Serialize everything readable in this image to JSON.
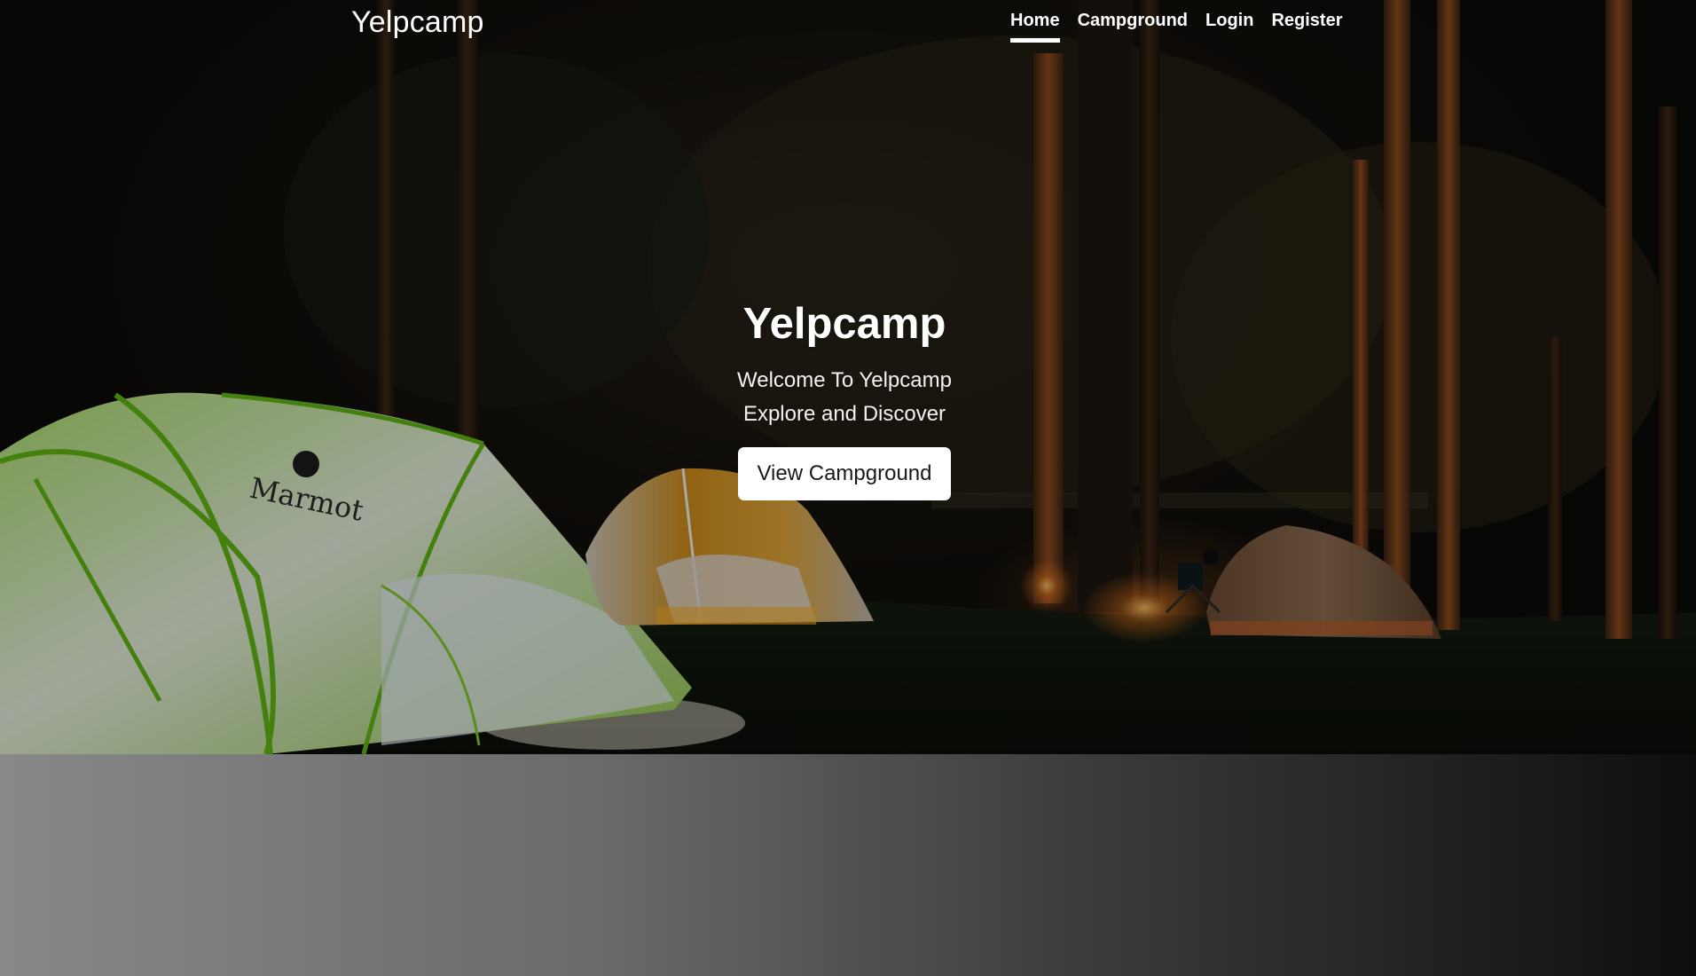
{
  "navbar": {
    "brand": "Yelpcamp",
    "links": [
      {
        "label": "Home",
        "active": true
      },
      {
        "label": "Campground",
        "active": false
      },
      {
        "label": "Login",
        "active": false
      },
      {
        "label": "Register",
        "active": false
      }
    ]
  },
  "hero": {
    "title": "Yelpcamp",
    "line1": "Welcome To Yelpcamp",
    "line2": "Explore and Discover",
    "cta_label": "View Campground",
    "tent_brand": "Marmot"
  },
  "colors": {
    "nav_text": "#ffffff",
    "cta_bg": "#ffffff",
    "cta_text": "#1a1a1a",
    "tent_green": "#7fc71c",
    "tent_orange": "#d08a18"
  }
}
